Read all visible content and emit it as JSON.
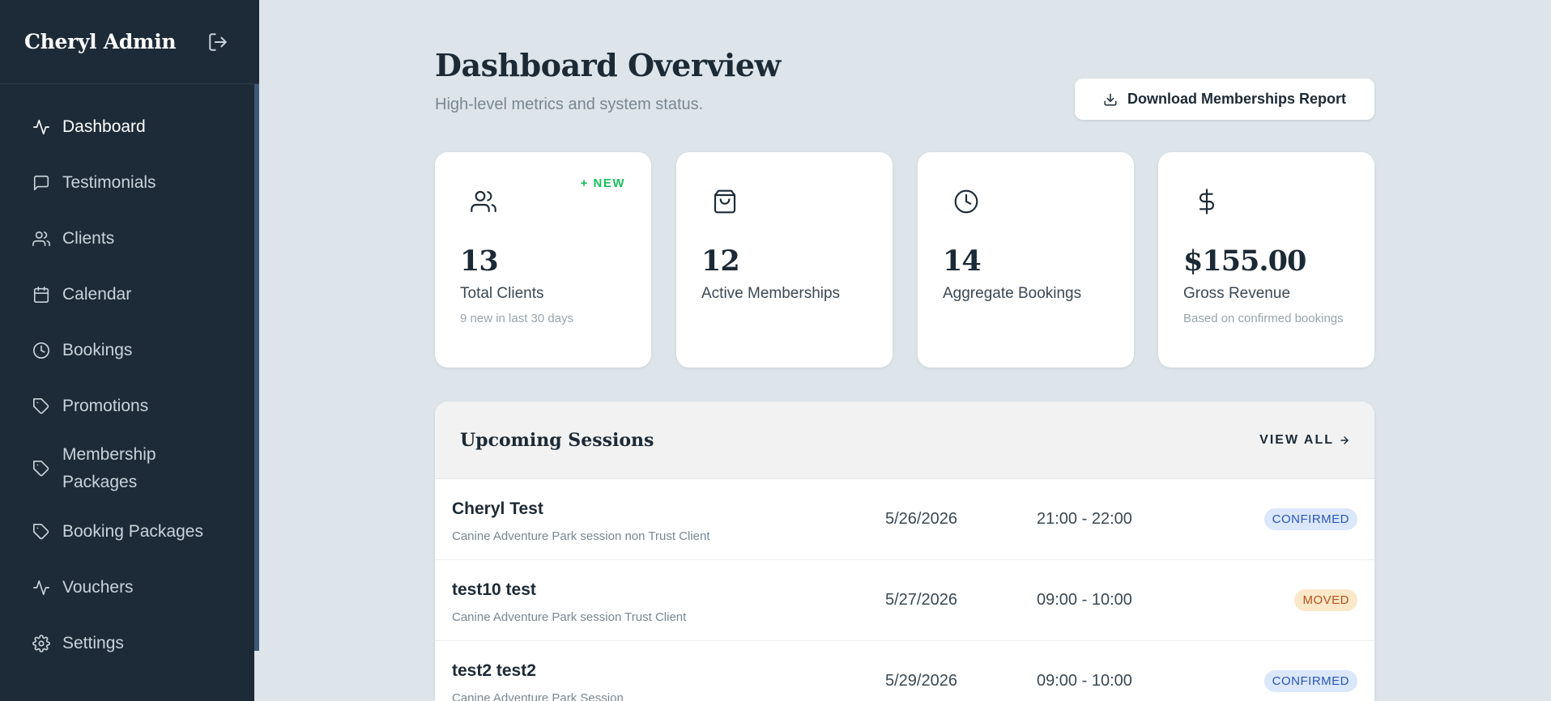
{
  "sidebar": {
    "brand": "Cheryl Admin",
    "items": [
      {
        "label": "Dashboard",
        "icon": "activity-icon",
        "active": true
      },
      {
        "label": "Testimonials",
        "icon": "message-square-icon"
      },
      {
        "label": "Clients",
        "icon": "users-icon"
      },
      {
        "label": "Calendar",
        "icon": "calendar-icon"
      },
      {
        "label": "Bookings",
        "icon": "clock-icon"
      },
      {
        "label": "Promotions",
        "icon": "tag-icon"
      },
      {
        "label": "Membership Packages",
        "icon": "tag-icon"
      },
      {
        "label": "Booking Packages",
        "icon": "tag-icon"
      },
      {
        "label": "Vouchers",
        "icon": "activity-icon"
      },
      {
        "label": "Settings",
        "icon": "gear-icon"
      }
    ]
  },
  "header": {
    "title": "Dashboard Overview",
    "subtitle": "High-level metrics and system status.",
    "download_label": "Download Memberships Report"
  },
  "cards": [
    {
      "value": "13",
      "label": "Total Clients",
      "note": "9 new in last 30 days",
      "badge": "+ NEW",
      "icon": "users-icon"
    },
    {
      "value": "12",
      "label": "Active Memberships",
      "note": "",
      "icon": "shopping-bag-icon"
    },
    {
      "value": "14",
      "label": "Aggregate Bookings",
      "note": "",
      "icon": "clock-icon"
    },
    {
      "value": "$155.00",
      "label": "Gross Revenue",
      "note": "Based on confirmed bookings",
      "icon": "dollar-icon"
    }
  ],
  "sessions": {
    "title": "Upcoming Sessions",
    "view_all": "VIEW ALL",
    "rows": [
      {
        "client": "Cheryl Test",
        "service": "Canine Adventure Park session non Trust Client",
        "date": "5/26/2026",
        "time": "21:00 - 22:00",
        "status": "CONFIRMED"
      },
      {
        "client": "test10 test",
        "service": "Canine Adventure Park session Trust Client",
        "date": "5/27/2026",
        "time": "09:00 - 10:00",
        "status": "MOVED"
      },
      {
        "client": "test2 test2",
        "service": "Canine Adventure Park Session",
        "date": "5/29/2026",
        "time": "09:00 - 10:00",
        "status": "CONFIRMED"
      }
    ]
  },
  "colors": {
    "sidebar_bg": "#1d2b38",
    "page_bg": "#dde5ea",
    "new_badge": "#19c15d",
    "confirmed_bg": "#dbe7fb",
    "confirmed_text": "#2a56b8",
    "moved_bg": "#fbe8c9",
    "moved_text": "#b5501a"
  }
}
